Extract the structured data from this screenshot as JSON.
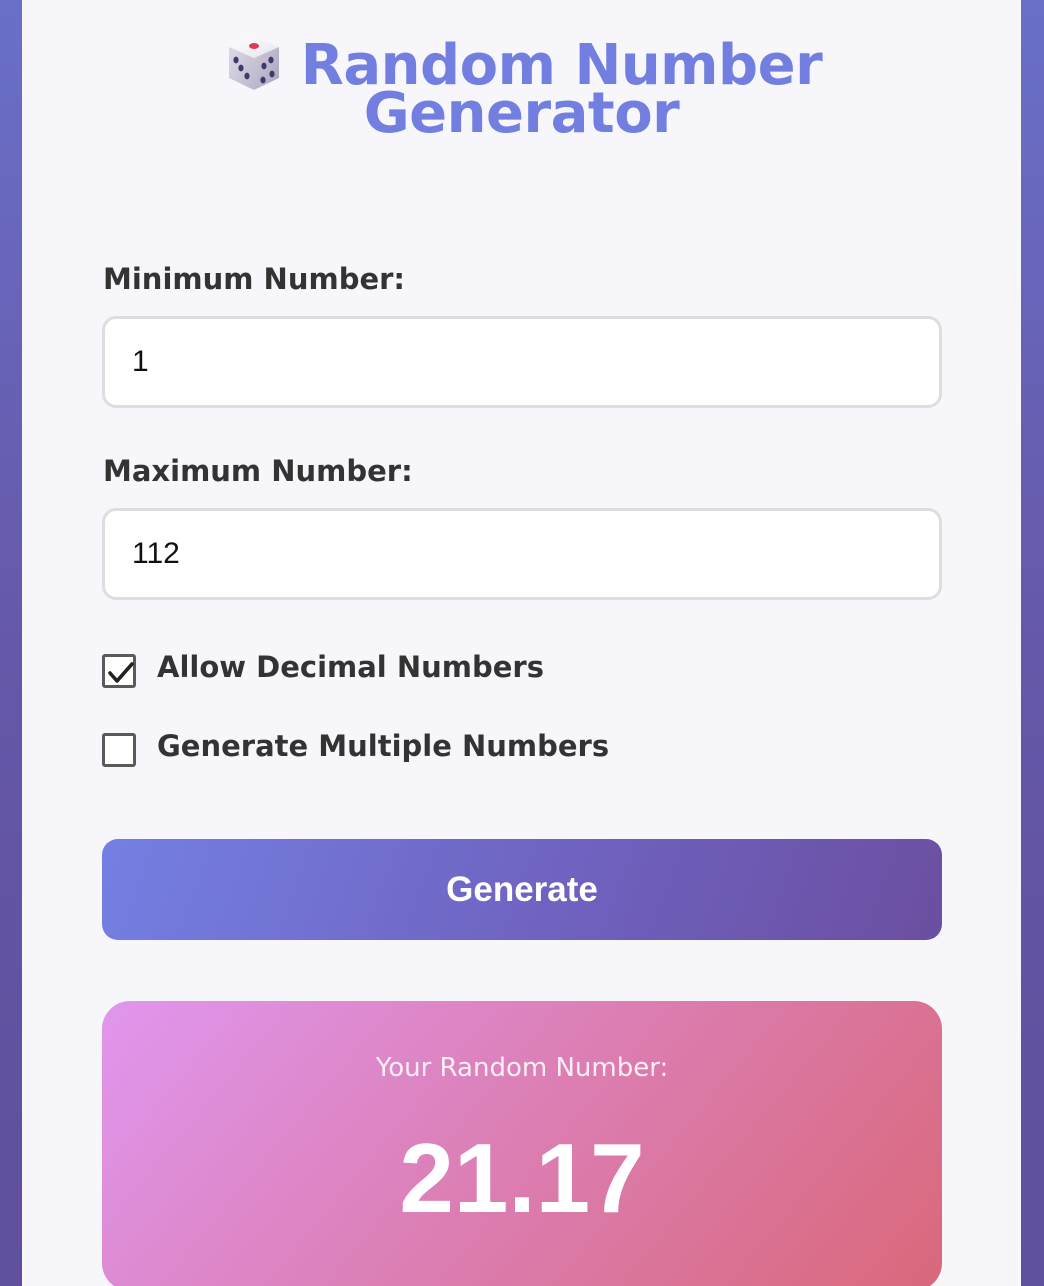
{
  "header": {
    "icon": "dice-icon",
    "title_line1": "Random Number",
    "title_line2": "Generator",
    "title_color": "#727fe0"
  },
  "form": {
    "min_label": "Minimum Number:",
    "min_value": "1",
    "max_label": "Maximum Number:",
    "max_value": "112",
    "allow_decimal_label": "Allow Decimal Numbers",
    "allow_decimal_checked": true,
    "multiple_label": "Generate Multiple Numbers",
    "multiple_checked": false
  },
  "actions": {
    "generate_label": "Generate"
  },
  "result": {
    "label": "Your Random Number:",
    "value": "21.17"
  },
  "colors": {
    "accent": "#727fe0",
    "button_start": "#7480e2",
    "button_end": "#6b4fa0",
    "result_start": "#e096ee",
    "result_end": "#d9687a",
    "background": "#6558a8"
  }
}
